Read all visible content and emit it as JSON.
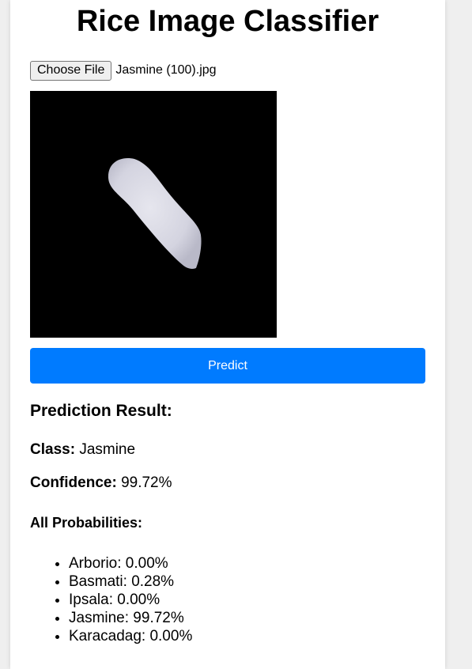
{
  "title": "Rice Image Classifier",
  "file_input": {
    "button_label": "Choose File",
    "file_name": "Jasmine (100).jpg"
  },
  "predict_button": "Predict",
  "result": {
    "heading": "Prediction Result:",
    "class_label": "Class:",
    "class_value": "Jasmine",
    "confidence_label": "Confidence:",
    "confidence_value": "99.72%",
    "all_probs_heading": "All Probabilities:",
    "probabilities": [
      "Arborio: 0.00%",
      "Basmati: 0.28%",
      "Ipsala: 0.00%",
      "Jasmine: 99.72%",
      "Karacadag: 0.00%"
    ]
  },
  "colors": {
    "accent": "#007bff",
    "background": "#efefef",
    "card": "#ffffff"
  }
}
